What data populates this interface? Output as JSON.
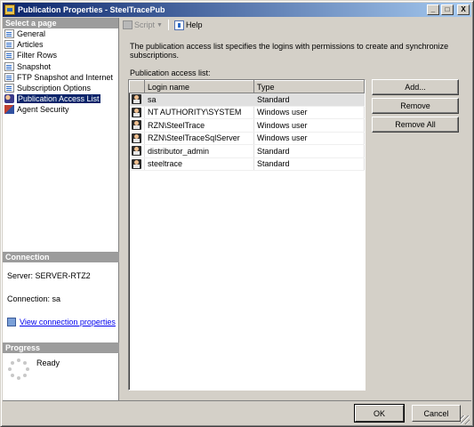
{
  "window": {
    "title": "Publication Properties - SteelTracePub",
    "minimize": "_",
    "maximize": "□",
    "close": "X"
  },
  "left_pane": {
    "select_page_header": "Select a page",
    "pages": [
      {
        "label": "General",
        "icon": "page-icon"
      },
      {
        "label": "Articles",
        "icon": "page-icon"
      },
      {
        "label": "Filter Rows",
        "icon": "page-icon"
      },
      {
        "label": "Snapshot",
        "icon": "page-icon"
      },
      {
        "label": "FTP Snapshot and Internet",
        "icon": "page-icon"
      },
      {
        "label": "Subscription Options",
        "icon": "page-icon"
      },
      {
        "label": "Publication Access List",
        "icon": "users-icon"
      },
      {
        "label": "Agent Security",
        "icon": "agent-icon"
      }
    ],
    "selected_page": "Publication Access List",
    "connection_header": "Connection",
    "server": "Server: SERVER-RTZ2",
    "connection": "Connection: sa",
    "view_connection_link": "View connection properties",
    "progress_header": "Progress",
    "progress_status": "Ready"
  },
  "toolbar": {
    "script_label": "Script",
    "help_label": "Help"
  },
  "main": {
    "description": "The publication access list specifies the logins with permissions to create and synchronize subscriptions.",
    "list_label": "Publication access list:",
    "columns": [
      "Login name",
      "Type"
    ],
    "rows": [
      {
        "login": "sa",
        "type": "Standard"
      },
      {
        "login": "NT AUTHORITY\\SYSTEM",
        "type": "Windows user"
      },
      {
        "login": "RZN\\SteelTrace",
        "type": "Windows user"
      },
      {
        "login": "RZN\\SteelTraceSqlServer",
        "type": "Windows user"
      },
      {
        "login": "distributor_admin",
        "type": "Standard"
      },
      {
        "login": "steeltrace",
        "type": "Standard"
      }
    ],
    "buttons": {
      "add": "Add...",
      "remove": "Remove",
      "remove_all": "Remove All"
    }
  },
  "footer": {
    "ok": "OK",
    "cancel": "Cancel"
  }
}
